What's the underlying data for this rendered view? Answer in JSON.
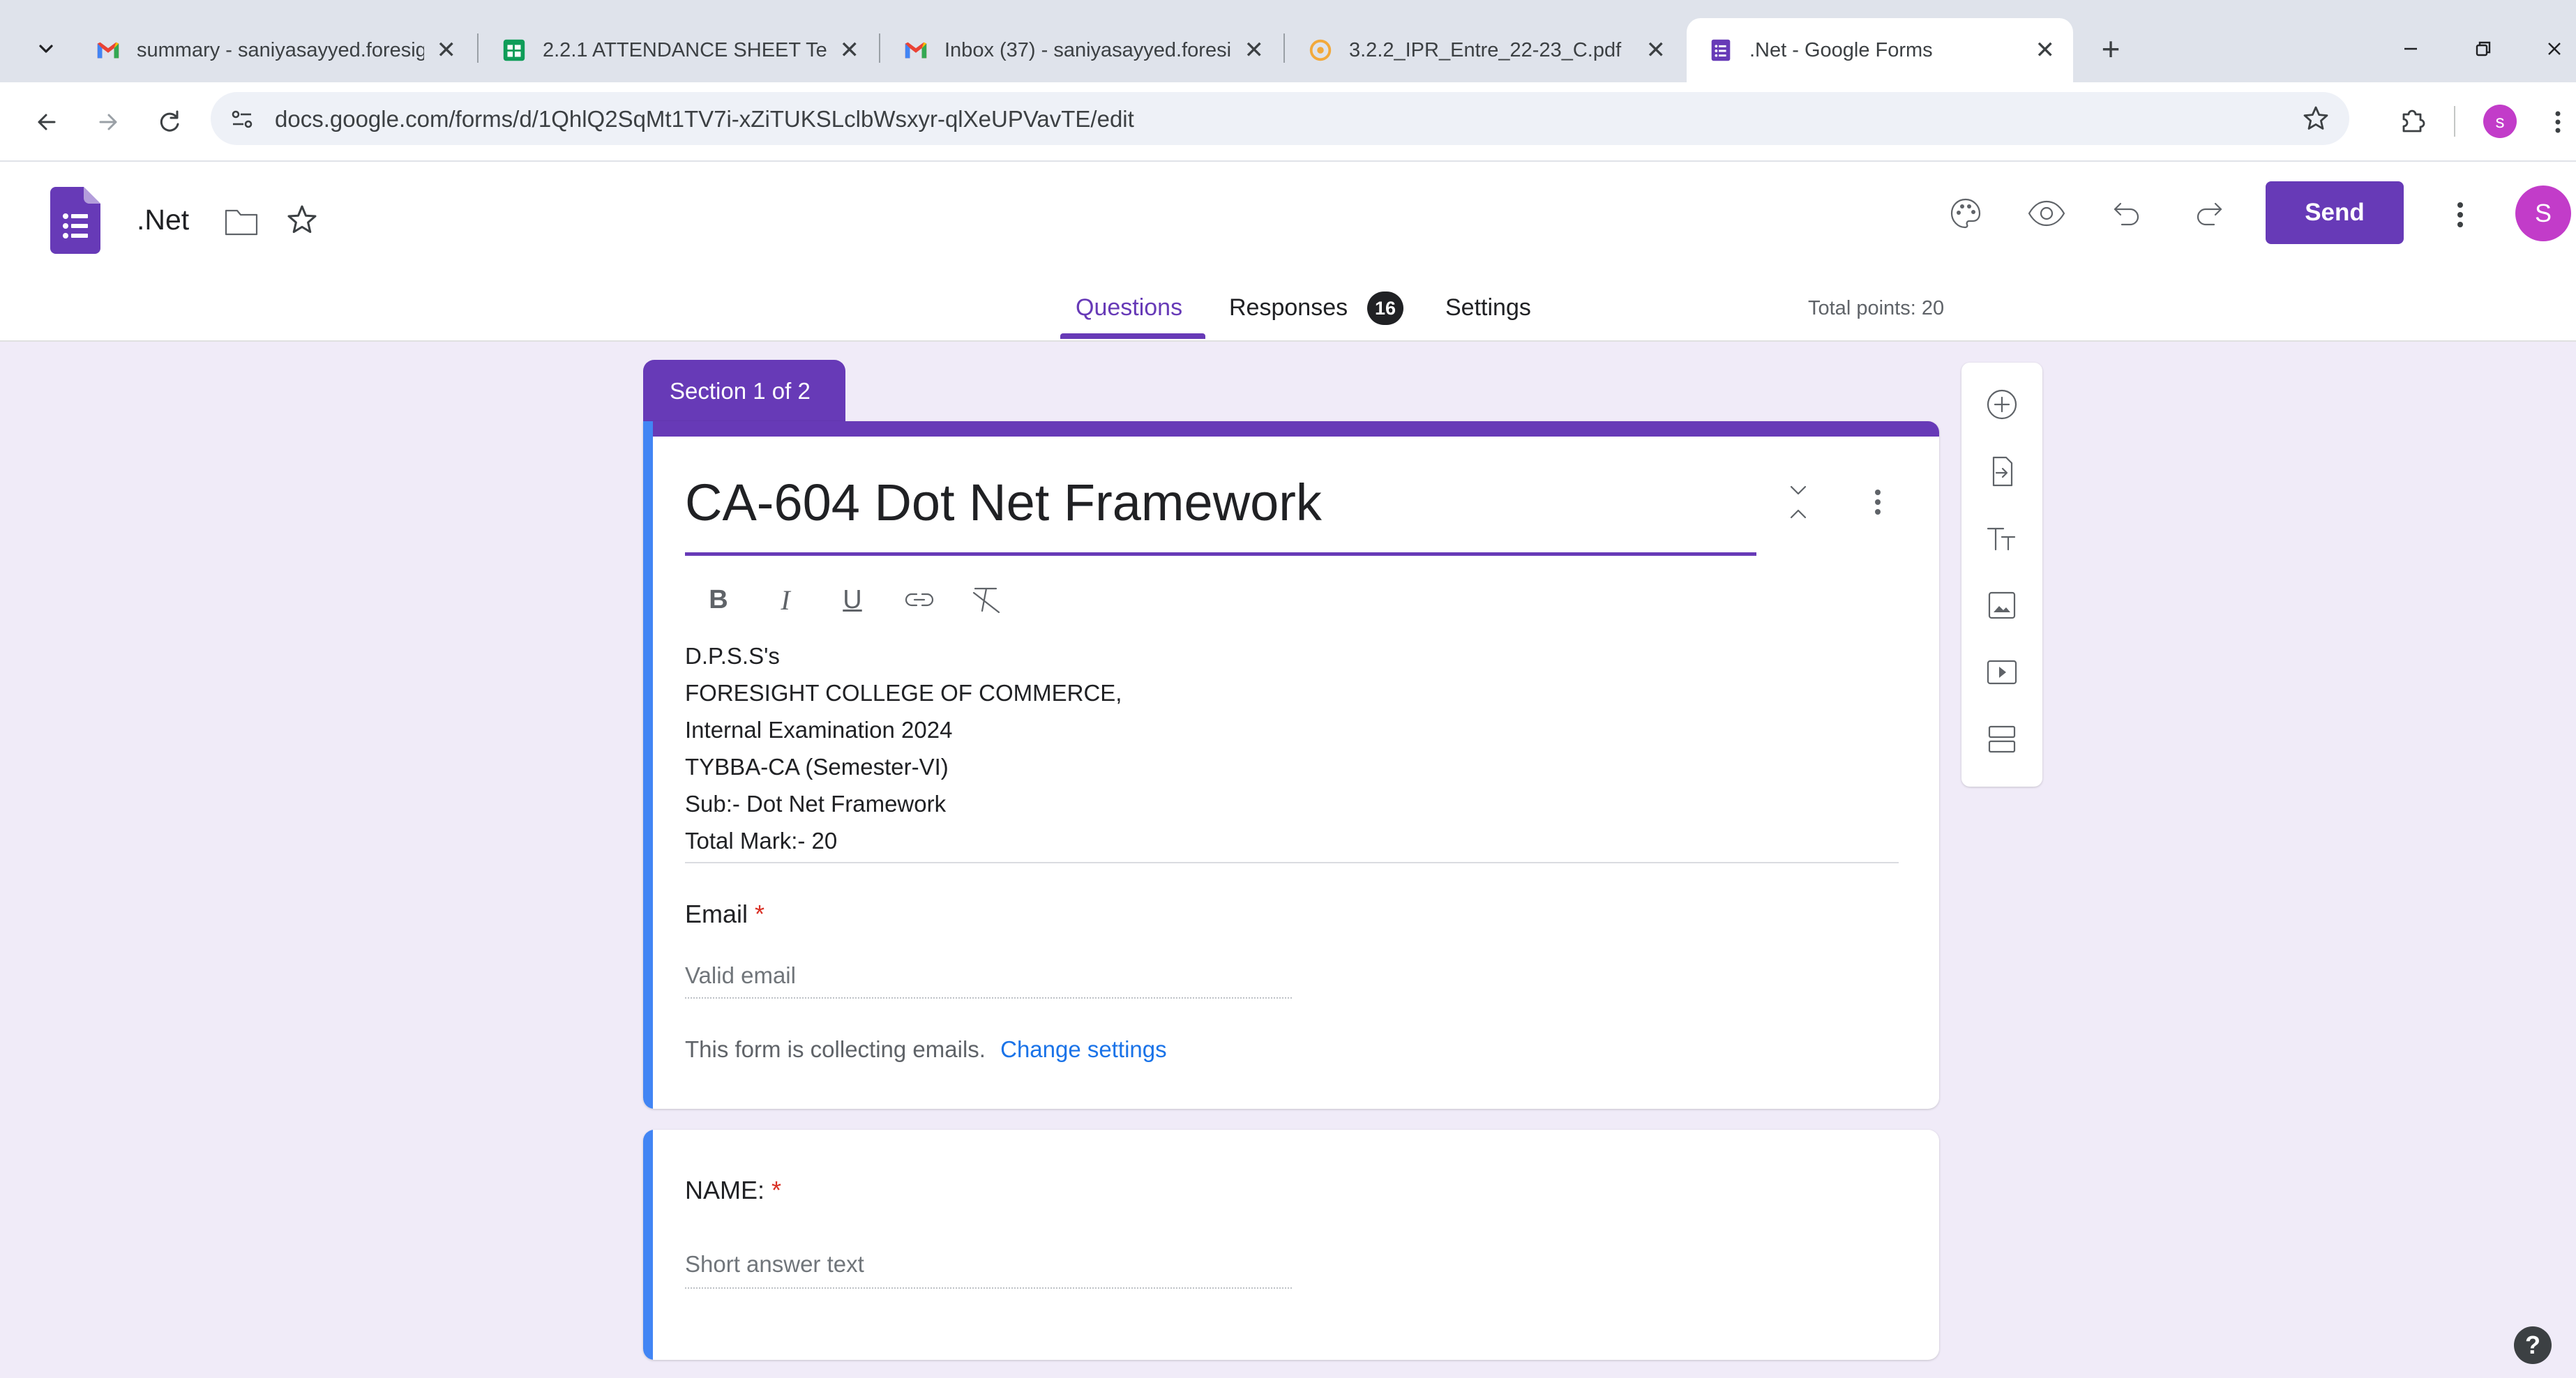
{
  "browser": {
    "tabs": [
      {
        "title": "summary - saniyasayyed.foresig",
        "icon": "gmail-icon"
      },
      {
        "title": "2.2.1 ATTENDANCE SHEET Term",
        "icon": "sheets-icon"
      },
      {
        "title": "Inbox (37) - saniyasayyed.foresi",
        "icon": "gmail-icon"
      },
      {
        "title": "3.2.2_IPR_Entre_22-23_C.pdf",
        "icon": "pdf-icon"
      },
      {
        "title": ".Net - Google Forms",
        "icon": "forms-icon",
        "active": true
      }
    ],
    "close_glyph": "✕",
    "new_tab_glyph": "+",
    "url": "docs.google.com/forms/d/1QhlQ2SqMt1TV7i-xZiTUKSLclbWsxyr-qlXeUPVavTE/edit",
    "profile_initial": "s"
  },
  "forms_app": {
    "doc_title": ".Net",
    "send_label": "Send",
    "avatar_initial": "S",
    "tabs": {
      "questions": "Questions",
      "responses": "Responses",
      "responses_count": "16",
      "settings": "Settings"
    },
    "total_points": "Total points: 20",
    "accent_color": "#673ab7"
  },
  "section": {
    "label": "Section 1 of 2",
    "title": "CA-604 Dot Net Framework",
    "description": [
      "D.P.S.S's",
      "FORESIGHT COLLEGE OF COMMERCE,",
      "Internal Examination 2024",
      "TYBBA-CA (Semester-VI)",
      "Sub:- Dot Net Framework",
      "Total Mark:- 20"
    ],
    "format_tools": {
      "bold": "B",
      "italic": "I",
      "underline": "U"
    }
  },
  "email_field": {
    "label": "Email",
    "required_mark": "*",
    "placeholder": "Valid email",
    "notice": "This form is collecting emails.",
    "change_settings": "Change settings"
  },
  "question_name": {
    "label": "NAME:",
    "required_mark": "*",
    "placeholder": "Short answer text"
  },
  "help_glyph": "?"
}
